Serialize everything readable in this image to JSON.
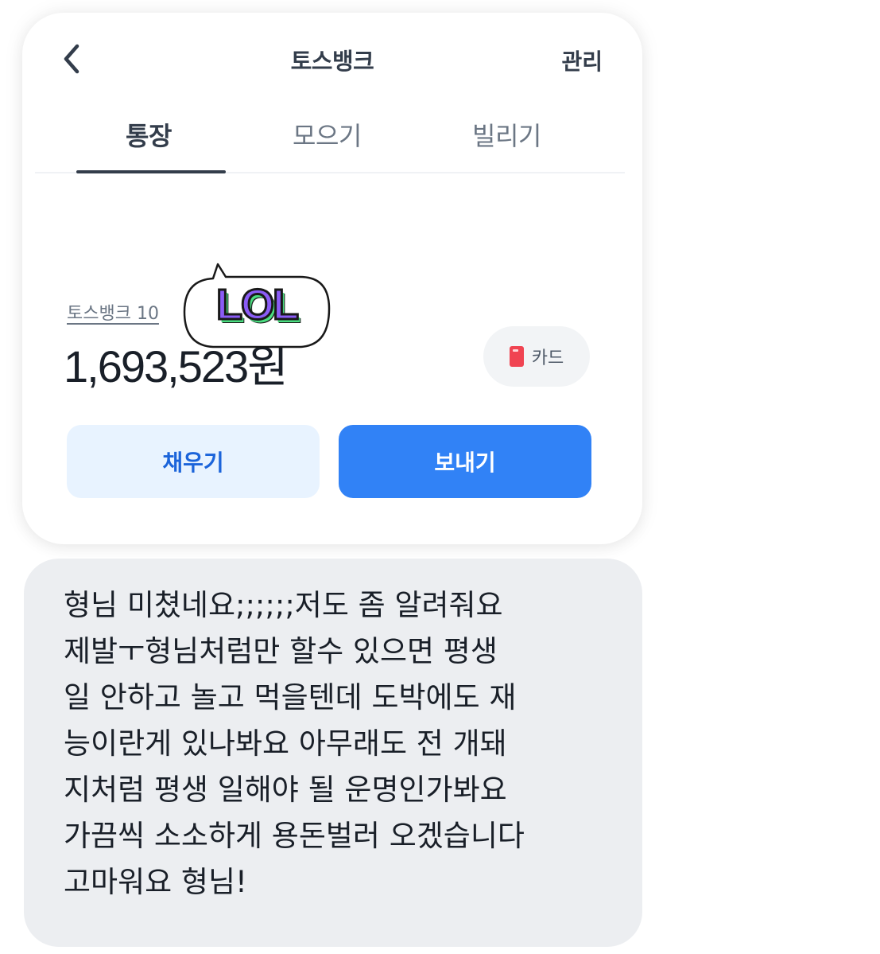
{
  "header": {
    "title": "토스뱅크",
    "manage_label": "관리",
    "back_icon": "chevron-left-icon"
  },
  "tabs": [
    {
      "label": "통장",
      "active": true
    },
    {
      "label": "모으기",
      "active": false
    },
    {
      "label": "빌리기",
      "active": false
    }
  ],
  "account": {
    "name": "토스뱅크 10",
    "balance": "1,693,523원"
  },
  "card_button": {
    "label": "카드",
    "icon": "card-icon",
    "icon_color": "#f04452"
  },
  "actions": {
    "fill_label": "채우기",
    "send_label": "보내기"
  },
  "sticker": {
    "text": "LOL"
  },
  "message": {
    "text": "형님 미쳤네요;;;;;;저도 좀 알려줘요\n제발ㅜ형님처럼만 할수 있으면 평생\n일 안하고 놀고 먹을텐데 도박에도 재\n능이란게 있나봐요 아무래도 전 개돼\n지처럼 평생 일해야 될 운명인가봐요\n가끔씩 소소하게 용돈벌러 오겠습니다\n고마워요 형님!"
  },
  "colors": {
    "accent": "#3182f6",
    "accent_light": "#e8f3ff",
    "text_dark": "#191f28",
    "text_gray": "#6b7684",
    "bubble_bg": "#eceef1"
  }
}
